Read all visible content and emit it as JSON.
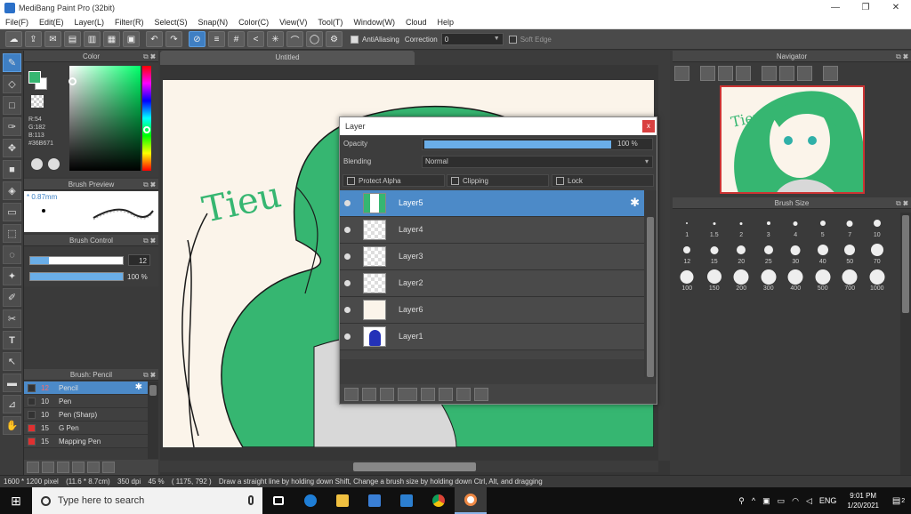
{
  "window": {
    "title": "MediBang Paint Pro (32bit)",
    "min": "—",
    "max": "❐",
    "close": "✕"
  },
  "menu": [
    "File(F)",
    "Edit(E)",
    "Layer(L)",
    "Filter(R)",
    "Select(S)",
    "Snap(N)",
    "Color(C)",
    "View(V)",
    "Tool(T)",
    "Window(W)",
    "Cloud",
    "Help"
  ],
  "toolbar": {
    "antialiasing_label": "AntiAliasing",
    "correction_label": "Correction",
    "correction_value": "0",
    "soft_edge_label": "Soft Edge"
  },
  "color_panel": {
    "title": "Color",
    "rgb_r": "R:54",
    "rgb_g": "G:182",
    "rgb_b": "B:113",
    "hex": "#36B671",
    "fg_color": "#36b671"
  },
  "brush_preview": {
    "title": "Brush Preview",
    "size": "* 0.87mm"
  },
  "brush_control": {
    "title": "Brush Control",
    "size_value": "12",
    "size_fill": 0.2,
    "opacity_value": "100 %",
    "opacity_fill": 1.0
  },
  "brush_list": {
    "title": "Brush: Pencil",
    "items": [
      {
        "size": "12",
        "name": "Pencil",
        "color": "#333333"
      },
      {
        "size": "10",
        "name": "Pen",
        "color": "#333333"
      },
      {
        "size": "10",
        "name": "Pen (Sharp)",
        "color": "#333333"
      },
      {
        "size": "15",
        "name": "G Pen",
        "color": "#e03030"
      },
      {
        "size": "15",
        "name": "Mapping Pen",
        "color": "#e03030"
      }
    ]
  },
  "canvas": {
    "tab_title": "Untitled"
  },
  "layer_panel": {
    "title": "Layer",
    "close": "x",
    "opacity_label": "Opacity",
    "opacity_value": "100 %",
    "opacity_fill": 1.0,
    "blending_label": "Blending",
    "blending_value": "Normal",
    "protect_alpha": "Protect Alpha",
    "clipping": "Clipping",
    "lock": "Lock",
    "layers": [
      {
        "name": "Layer5",
        "active": true
      },
      {
        "name": "Layer4",
        "active": false
      },
      {
        "name": "Layer3",
        "active": false
      },
      {
        "name": "Layer2",
        "active": false
      },
      {
        "name": "Layer6",
        "active": false
      },
      {
        "name": "Layer1",
        "active": false
      }
    ]
  },
  "navigator": {
    "title": "Navigator"
  },
  "brush_size": {
    "title": "Brush Size",
    "sizes": [
      "1",
      "1.5",
      "2",
      "3",
      "4",
      "5",
      "7",
      "10",
      "12",
      "15",
      "20",
      "25",
      "30",
      "40",
      "50",
      "70",
      "100",
      "150",
      "200",
      "300",
      "400",
      "500",
      "700",
      "1000"
    ]
  },
  "status": {
    "dimensions": "1600 * 1200 pixel",
    "physical": "(11.6 * 8.7cm)",
    "dpi": "350 dpi",
    "zoom": "45 %",
    "coords": "( 1175, 792 )",
    "hint": "Draw a straight line by holding down Shift, Change a brush size by holding down Ctrl, Alt, and dragging"
  },
  "taskbar": {
    "search_placeholder": "Type here to search",
    "time": "9:01 PM",
    "date": "1/20/2021",
    "lang": "ENG",
    "notif_count": "2"
  },
  "artwork_text": "Tieu"
}
